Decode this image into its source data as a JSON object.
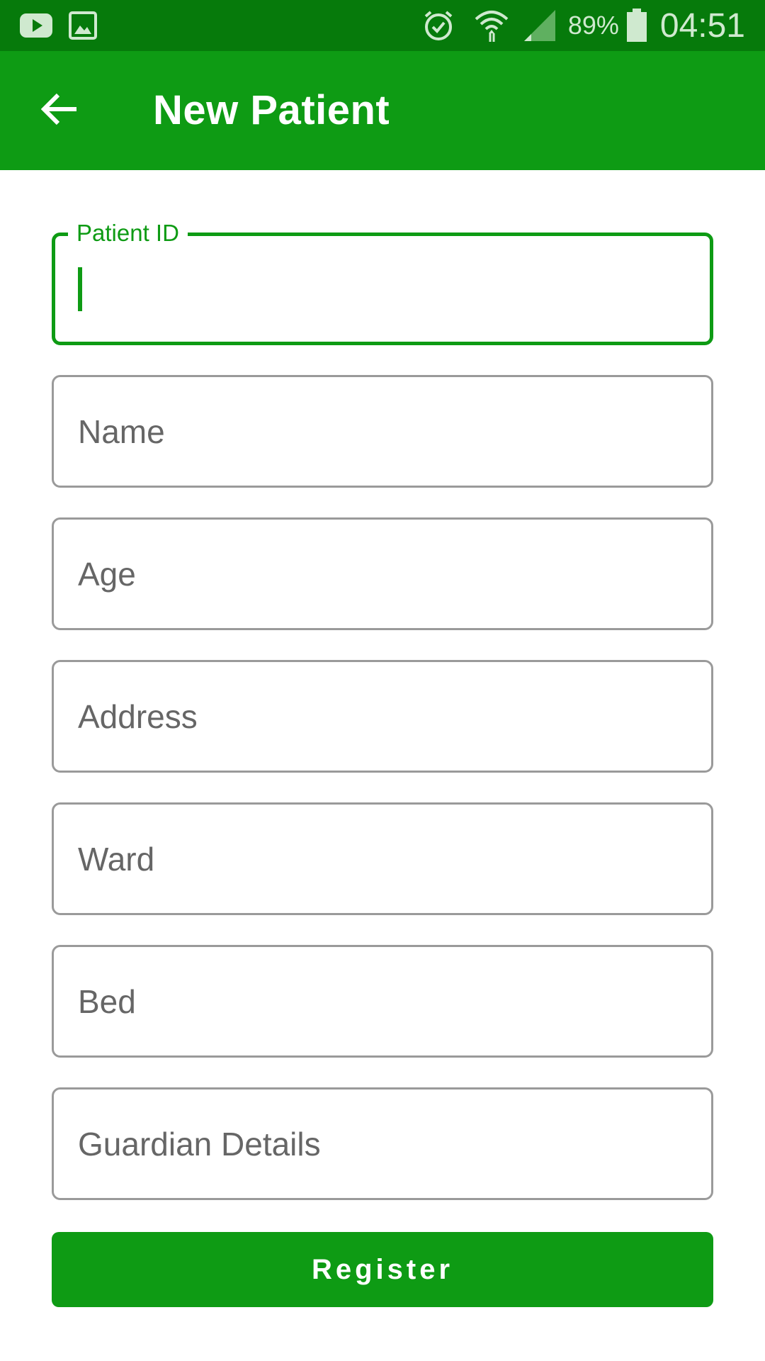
{
  "status_bar": {
    "battery_percent": "89%",
    "time": "04:51",
    "icons": [
      "youtube-icon",
      "gallery-icon",
      "alarm-icon",
      "wifi-icon",
      "signal-icon",
      "battery-icon"
    ]
  },
  "app_bar": {
    "title": "New Patient",
    "back_icon": "arrow-left-icon"
  },
  "form": {
    "fields": [
      {
        "label": "Patient ID",
        "value": "",
        "focused": true
      },
      {
        "placeholder": "Name",
        "value": ""
      },
      {
        "placeholder": "Age",
        "value": ""
      },
      {
        "placeholder": "Address",
        "value": ""
      },
      {
        "placeholder": "Ward",
        "value": ""
      },
      {
        "placeholder": "Bed",
        "value": ""
      },
      {
        "placeholder": "Guardian Details",
        "value": ""
      }
    ],
    "submit_label": "Register"
  },
  "colors": {
    "status_bar": "#067a0b",
    "primary": "#0e9b14",
    "field_border": "#9a9a9a",
    "hint_text": "#666666"
  }
}
